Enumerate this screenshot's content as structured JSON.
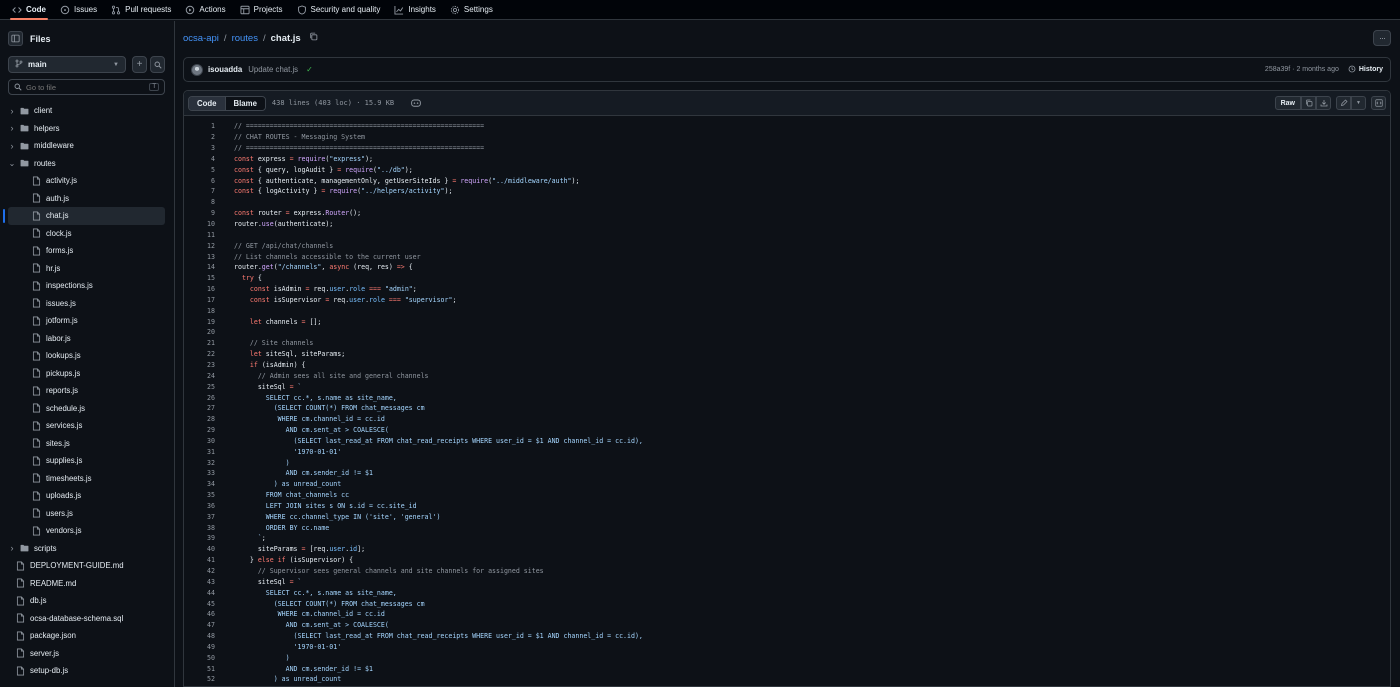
{
  "nav": {
    "tabs": [
      {
        "label": "Code",
        "icon": "code-icon",
        "active": true
      },
      {
        "label": "Issues",
        "icon": "issue-icon"
      },
      {
        "label": "Pull requests",
        "icon": "pull-request-icon"
      },
      {
        "label": "Actions",
        "icon": "play-icon"
      },
      {
        "label": "Projects",
        "icon": "table-icon"
      },
      {
        "label": "Security and quality",
        "icon": "shield-icon"
      },
      {
        "label": "Insights",
        "icon": "graph-icon"
      },
      {
        "label": "Settings",
        "icon": "gear-icon"
      }
    ]
  },
  "sidebar": {
    "title": "Files",
    "branch": "main",
    "goto_placeholder": "Go to file",
    "goto_shortcut": "T",
    "tree": [
      {
        "name": "client",
        "type": "folder",
        "level": 0,
        "expanded": false
      },
      {
        "name": "helpers",
        "type": "folder",
        "level": 0,
        "expanded": false
      },
      {
        "name": "middleware",
        "type": "folder",
        "level": 0,
        "expanded": false
      },
      {
        "name": "routes",
        "type": "folder",
        "level": 0,
        "expanded": true
      },
      {
        "name": "activity.js",
        "type": "file",
        "level": 1
      },
      {
        "name": "auth.js",
        "type": "file",
        "level": 1
      },
      {
        "name": "chat.js",
        "type": "file",
        "level": 1,
        "selected": true
      },
      {
        "name": "clock.js",
        "type": "file",
        "level": 1
      },
      {
        "name": "forms.js",
        "type": "file",
        "level": 1
      },
      {
        "name": "hr.js",
        "type": "file",
        "level": 1
      },
      {
        "name": "inspections.js",
        "type": "file",
        "level": 1
      },
      {
        "name": "issues.js",
        "type": "file",
        "level": 1
      },
      {
        "name": "jotform.js",
        "type": "file",
        "level": 1
      },
      {
        "name": "labor.js",
        "type": "file",
        "level": 1
      },
      {
        "name": "lookups.js",
        "type": "file",
        "level": 1
      },
      {
        "name": "pickups.js",
        "type": "file",
        "level": 1
      },
      {
        "name": "reports.js",
        "type": "file",
        "level": 1
      },
      {
        "name": "schedule.js",
        "type": "file",
        "level": 1
      },
      {
        "name": "services.js",
        "type": "file",
        "level": 1
      },
      {
        "name": "sites.js",
        "type": "file",
        "level": 1
      },
      {
        "name": "supplies.js",
        "type": "file",
        "level": 1
      },
      {
        "name": "timesheets.js",
        "type": "file",
        "level": 1
      },
      {
        "name": "uploads.js",
        "type": "file",
        "level": 1
      },
      {
        "name": "users.js",
        "type": "file",
        "level": 1
      },
      {
        "name": "vendors.js",
        "type": "file",
        "level": 1
      },
      {
        "name": "scripts",
        "type": "folder",
        "level": 0,
        "expanded": false
      },
      {
        "name": "DEPLOYMENT-GUIDE.md",
        "type": "file",
        "level": 0
      },
      {
        "name": "README.md",
        "type": "file",
        "level": 0
      },
      {
        "name": "db.js",
        "type": "file",
        "level": 0
      },
      {
        "name": "ocsa-database-schema.sql",
        "type": "file",
        "level": 0
      },
      {
        "name": "package.json",
        "type": "file",
        "level": 0
      },
      {
        "name": "server.js",
        "type": "file",
        "level": 0
      },
      {
        "name": "setup-db.js",
        "type": "file",
        "level": 0
      }
    ]
  },
  "breadcrumb": {
    "repo": "ocsa-api",
    "folder": "routes",
    "file": "chat.js"
  },
  "commit": {
    "author": "isouadda",
    "message": "Update chat.js",
    "meta": "258a39f · 2 months ago",
    "history_label": "History"
  },
  "file_header": {
    "code_tab": "Code",
    "blame_tab": "Blame",
    "info": "438 lines (403 loc) · 15.9 KB",
    "raw_label": "Raw"
  },
  "code_lines": [
    {
      "n": 1,
      "html": "<span class='cm'>// ============================================================</span>"
    },
    {
      "n": 2,
      "html": "<span class='cm'>// CHAT ROUTES - Messaging System</span>"
    },
    {
      "n": 3,
      "html": "<span class='cm'>// ============================================================</span>"
    },
    {
      "n": 4,
      "html": "<span class='kw'>const</span> express <span class='kw'>=</span> <span class='fn'>require</span>(<span class='st'>\"express\"</span>);"
    },
    {
      "n": 5,
      "html": "<span class='kw'>const</span> { query, logAudit } <span class='kw'>=</span> <span class='fn'>require</span>(<span class='st'>\"../db\"</span>);"
    },
    {
      "n": 6,
      "html": "<span class='kw'>const</span> { authenticate, managementOnly, getUserSiteIds } <span class='kw'>=</span> <span class='fn'>require</span>(<span class='st'>\"../middleware/auth\"</span>);"
    },
    {
      "n": 7,
      "html": "<span class='kw'>const</span> { logActivity } <span class='kw'>=</span> <span class='fn'>require</span>(<span class='st'>\"../helpers/activity\"</span>);"
    },
    {
      "n": 8,
      "html": ""
    },
    {
      "n": 9,
      "html": "<span class='kw'>const</span> router <span class='kw'>=</span> express.<span class='fn'>Router</span>();"
    },
    {
      "n": 10,
      "html": "router.<span class='fn'>use</span>(authenticate);"
    },
    {
      "n": 11,
      "html": ""
    },
    {
      "n": 12,
      "html": "<span class='cm'>// GET /api/chat/channels</span>"
    },
    {
      "n": 13,
      "html": "<span class='cm'>// List channels accessible to the current user</span>"
    },
    {
      "n": 14,
      "html": "router.<span class='fn'>get</span>(<span class='st'>\"/channels\"</span>, <span class='kw'>async</span> (req, res) <span class='kw'>=&gt;</span> {"
    },
    {
      "n": 15,
      "html": "  <span class='kw'>try</span> {"
    },
    {
      "n": 16,
      "html": "    <span class='kw'>const</span> isAdmin <span class='kw'>=</span> req.<span class='pr'>user</span>.<span class='pr'>role</span> <span class='kw'>===</span> <span class='st'>\"admin\"</span>;"
    },
    {
      "n": 17,
      "html": "    <span class='kw'>const</span> isSupervisor <span class='kw'>=</span> req.<span class='pr'>user</span>.<span class='pr'>role</span> <span class='kw'>===</span> <span class='st'>\"supervisor\"</span>;"
    },
    {
      "n": 18,
      "html": ""
    },
    {
      "n": 19,
      "html": "    <span class='kw'>let</span> channels <span class='kw'>=</span> [];"
    },
    {
      "n": 20,
      "html": ""
    },
    {
      "n": 21,
      "html": "    <span class='cm'>// Site channels</span>"
    },
    {
      "n": 22,
      "html": "    <span class='kw'>let</span> siteSql, siteParams;"
    },
    {
      "n": 23,
      "html": "    <span class='kw'>if</span> (isAdmin) {"
    },
    {
      "n": 24,
      "html": "      <span class='cm'>// Admin sees all site and general channels</span>"
    },
    {
      "n": 25,
      "html": "      siteSql <span class='kw'>=</span> <span class='st'>`</span>"
    },
    {
      "n": 26,
      "html": "<span class='st'>        SELECT cc.*, s.name as site_name,</span>"
    },
    {
      "n": 27,
      "html": "<span class='st'>          (SELECT COUNT(*) FROM chat_messages cm</span>"
    },
    {
      "n": 28,
      "html": "<span class='st'>           WHERE cm.channel_id = cc.id</span>"
    },
    {
      "n": 29,
      "html": "<span class='st'>             AND cm.sent_at &gt; COALESCE(</span>"
    },
    {
      "n": 30,
      "html": "<span class='st'>               (SELECT last_read_at FROM chat_read_receipts WHERE user_id = $1 AND channel_id = cc.id),</span>"
    },
    {
      "n": 31,
      "html": "<span class='st'>               '1970-01-01'</span>"
    },
    {
      "n": 32,
      "html": "<span class='st'>             )</span>"
    },
    {
      "n": 33,
      "html": "<span class='st'>             AND cm.sender_id != $1</span>"
    },
    {
      "n": 34,
      "html": "<span class='st'>          ) as unread_count</span>"
    },
    {
      "n": 35,
      "html": "<span class='st'>        FROM chat_channels cc</span>"
    },
    {
      "n": 36,
      "html": "<span class='st'>        LEFT JOIN sites s ON s.id = cc.site_id</span>"
    },
    {
      "n": 37,
      "html": "<span class='st'>        WHERE cc.channel_type IN ('site', 'general')</span>"
    },
    {
      "n": 38,
      "html": "<span class='st'>        ORDER BY cc.name</span>"
    },
    {
      "n": 39,
      "html": "<span class='st'>      `</span>;"
    },
    {
      "n": 40,
      "html": "      siteParams <span class='kw'>=</span> [req.<span class='pr'>user</span>.<span class='pr'>id</span>];"
    },
    {
      "n": 41,
      "html": "    } <span class='kw'>else</span> <span class='kw'>if</span> (isSupervisor) {"
    },
    {
      "n": 42,
      "html": "      <span class='cm'>// Supervisor sees general channels and site channels for assigned sites</span>"
    },
    {
      "n": 43,
      "html": "      siteSql <span class='kw'>=</span> <span class='st'>`</span>"
    },
    {
      "n": 44,
      "html": "<span class='st'>        SELECT cc.*, s.name as site_name,</span>"
    },
    {
      "n": 45,
      "html": "<span class='st'>          (SELECT COUNT(*) FROM chat_messages cm</span>"
    },
    {
      "n": 46,
      "html": "<span class='st'>           WHERE cm.channel_id = cc.id</span>"
    },
    {
      "n": 47,
      "html": "<span class='st'>             AND cm.sent_at &gt; COALESCE(</span>"
    },
    {
      "n": 48,
      "html": "<span class='st'>               (SELECT last_read_at FROM chat_read_receipts WHERE user_id = $1 AND channel_id = cc.id),</span>"
    },
    {
      "n": 49,
      "html": "<span class='st'>               '1970-01-01'</span>"
    },
    {
      "n": 50,
      "html": "<span class='st'>             )</span>"
    },
    {
      "n": 51,
      "html": "<span class='st'>             AND cm.sender_id != $1</span>"
    },
    {
      "n": 52,
      "html": "<span class='st'>          ) as unread_count</span>"
    }
  ]
}
